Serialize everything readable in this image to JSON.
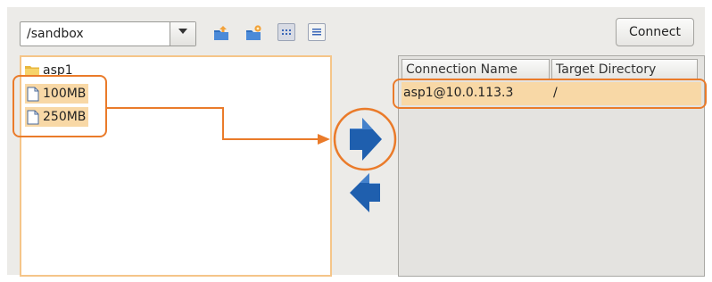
{
  "left": {
    "path_value": "/sandbox",
    "toolbar_icons": [
      "folder-up-icon",
      "new-folder-icon",
      "icon-view-icon",
      "list-view-icon"
    ],
    "tree": [
      {
        "label": "asp1",
        "icon": "folder-icon",
        "selected": false
      },
      {
        "label": "100MB",
        "icon": "file-icon",
        "selected": true
      },
      {
        "label": "250MB",
        "icon": "file-icon",
        "selected": true
      }
    ]
  },
  "transfer": {
    "icons": [
      "arrow-right-icon",
      "arrow-left-icon"
    ]
  },
  "right": {
    "connect_label": "Connect",
    "columns": [
      "Connection Name",
      "Target Directory"
    ],
    "rows": [
      {
        "name": "asp1@10.0.113.3",
        "dir": "/",
        "selected": true
      }
    ]
  },
  "colors": {
    "highlight": "#ea7b2a",
    "selection": "#f8d8a6",
    "arrow": "#1f5fae"
  }
}
